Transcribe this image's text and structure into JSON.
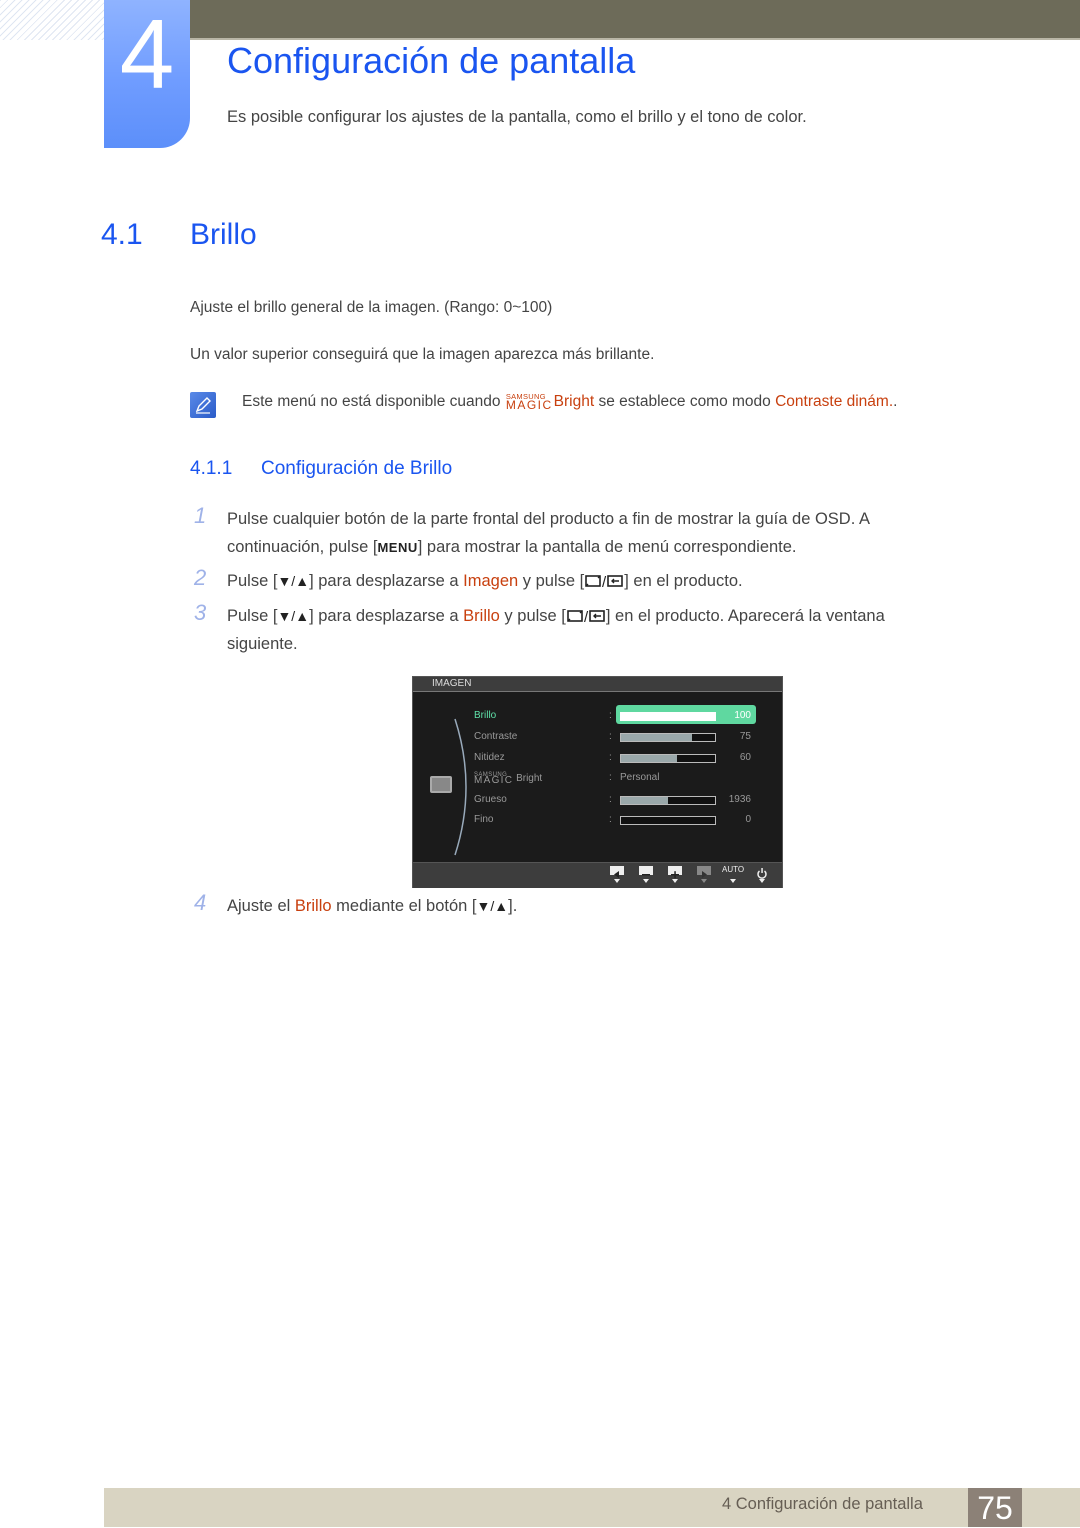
{
  "chapter": {
    "number": "4",
    "title": "Configuración de pantalla",
    "intro": "Es posible configurar los ajustes de la pantalla, como el brillo y el tono de color."
  },
  "section": {
    "number": "4.1",
    "title": "Brillo",
    "para1": "Ajuste el brillo general de la imagen. (Rango: 0~100)",
    "para2": "Un valor superior conseguirá que la imagen aparezca más brillante."
  },
  "note": {
    "icon": "note-pencil-icon",
    "text_before": "Este menú no está disponible cuando ",
    "magic_samsung": "SAMSUNG",
    "magic_magic": "MAGIC",
    "magic_bright": "Bright",
    "text_middle": " se establece como modo ",
    "highlight": "Contraste dinám.",
    "text_after": "."
  },
  "subsection": {
    "number": "4.1.1",
    "title": "Configuración de Brillo"
  },
  "steps": [
    {
      "number": "1",
      "line1": "Pulse cualquier botón de la parte frontal del producto a fin de mostrar la guía de OSD. A",
      "line2_before": "continuación, pulse [",
      "key": "MENU",
      "line2_after": "] para mostrar la pantalla de menú correspondiente."
    },
    {
      "number": "2",
      "before": "Pulse [",
      "arrows": "▼/▲",
      "middle": "] para desplazarse a ",
      "target": "Imagen",
      "middle2": " y pulse [",
      "after": "] en el producto."
    },
    {
      "number": "3",
      "before": "Pulse [",
      "arrows": "▼/▲",
      "middle": "] para desplazarse a ",
      "target": "Brillo",
      "middle2": " y pulse [",
      "after": "] en el producto. Aparecerá la ventana",
      "line2": "siguiente."
    },
    {
      "number": "4",
      "before": "Ajuste el ",
      "target": "Brillo",
      "middle": " mediante el botón [",
      "arrows": "▼/▲",
      "after": "]."
    }
  ],
  "osd": {
    "header": "IMAGEN",
    "rows": [
      {
        "label": "Brillo",
        "value": "100",
        "fraction": 1.0,
        "selected": true
      },
      {
        "label": "Contraste",
        "value": "75",
        "fraction": 0.75
      },
      {
        "label": "Nitidez",
        "value": "60",
        "fraction": 0.6
      },
      {
        "label_samsung": "SAMSUNG",
        "label_magic": "MAGIC",
        "label_bright": "Bright",
        "text": "Personal"
      },
      {
        "label": "Grueso",
        "value": "1936",
        "fraction": 0.5
      },
      {
        "label": "Fino",
        "value": "0",
        "fraction": 0.0
      }
    ],
    "buttons": [
      {
        "icon": "left-arrow-icon"
      },
      {
        "icon": "minus-icon"
      },
      {
        "icon": "plus-icon"
      },
      {
        "icon": "enter-icon"
      },
      {
        "label": "AUTO"
      },
      {
        "icon": "power-icon"
      }
    ]
  },
  "footer": {
    "section": "4 Configuración de pantalla",
    "page": "75"
  },
  "colors": {
    "heading_blue": "#1a55f0",
    "highlight_orange": "#c8400f",
    "osd_selected": "#5fd8a0"
  }
}
